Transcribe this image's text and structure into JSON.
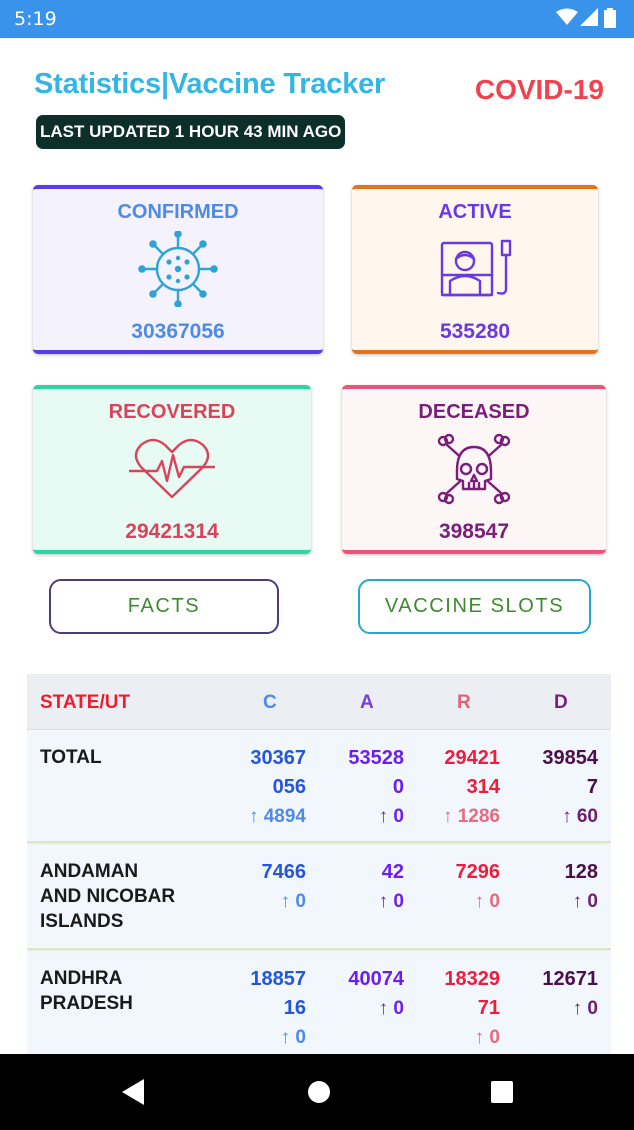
{
  "status_bar": {
    "time": "5:19"
  },
  "header": {
    "title": "Statistics|Vaccine Tracker",
    "brand": "COVID-19",
    "last_updated": "LAST UPDATED 1 HOUR 43 MIN AGO"
  },
  "cards": {
    "confirmed": {
      "label": "CONFIRMED",
      "value": "30367056",
      "icon": "virus-icon"
    },
    "active": {
      "label": "ACTIVE",
      "value": "535280",
      "icon": "patient-bed-icon"
    },
    "recovered": {
      "label": "RECOVERED",
      "value": "29421314",
      "icon": "heartbeat-icon"
    },
    "deceased": {
      "label": "DECEASED",
      "value": "398547",
      "icon": "skull-crossbones-icon"
    }
  },
  "buttons": {
    "facts": "FACTS",
    "vaccine_slots": "VACCINE SLOTS"
  },
  "table": {
    "headers": {
      "state": "STATE/UT",
      "c": "C",
      "a": "A",
      "r": "R",
      "d": "D"
    },
    "rows": [
      {
        "state": [
          "TOTAL"
        ],
        "c": [
          "30367",
          "056"
        ],
        "c_delta": "↑ 4894",
        "a": [
          "53528",
          "0"
        ],
        "a_delta": "↑ 0",
        "r": [
          "29421",
          "314"
        ],
        "r_delta": "↑ 1286",
        "d": [
          "39854",
          "7"
        ],
        "d_delta": "↑ 60"
      },
      {
        "state": [
          "ANDAMAN",
          "AND NICOBAR",
          "ISLANDS"
        ],
        "c": [
          "7466"
        ],
        "c_delta": "↑ 0",
        "a": [
          "42"
        ],
        "a_delta": "↑ 0",
        "r": [
          "7296"
        ],
        "r_delta": "↑ 0",
        "d": [
          "128"
        ],
        "d_delta": "↑ 0"
      },
      {
        "state": [
          "ANDHRA",
          "PRADESH"
        ],
        "c": [
          "18857",
          "16"
        ],
        "c_delta": "↑ 0",
        "a": [
          "40074"
        ],
        "a_delta": "↑ 0",
        "r": [
          "18329",
          "71"
        ],
        "r_delta": "↑ 0",
        "d": [
          "12671"
        ],
        "d_delta": "↑ 0"
      }
    ]
  },
  "colors": {
    "status_bar": "#3a93ea",
    "title": "#33b5e5",
    "brand": "#f0424f",
    "confirmed": "#4f8ae4",
    "active": "#6a3ae0",
    "recovered": "#d8455a",
    "deceased": "#7a1e7a"
  },
  "nav": {
    "icons": [
      "back-icon",
      "home-icon",
      "recents-icon"
    ]
  }
}
